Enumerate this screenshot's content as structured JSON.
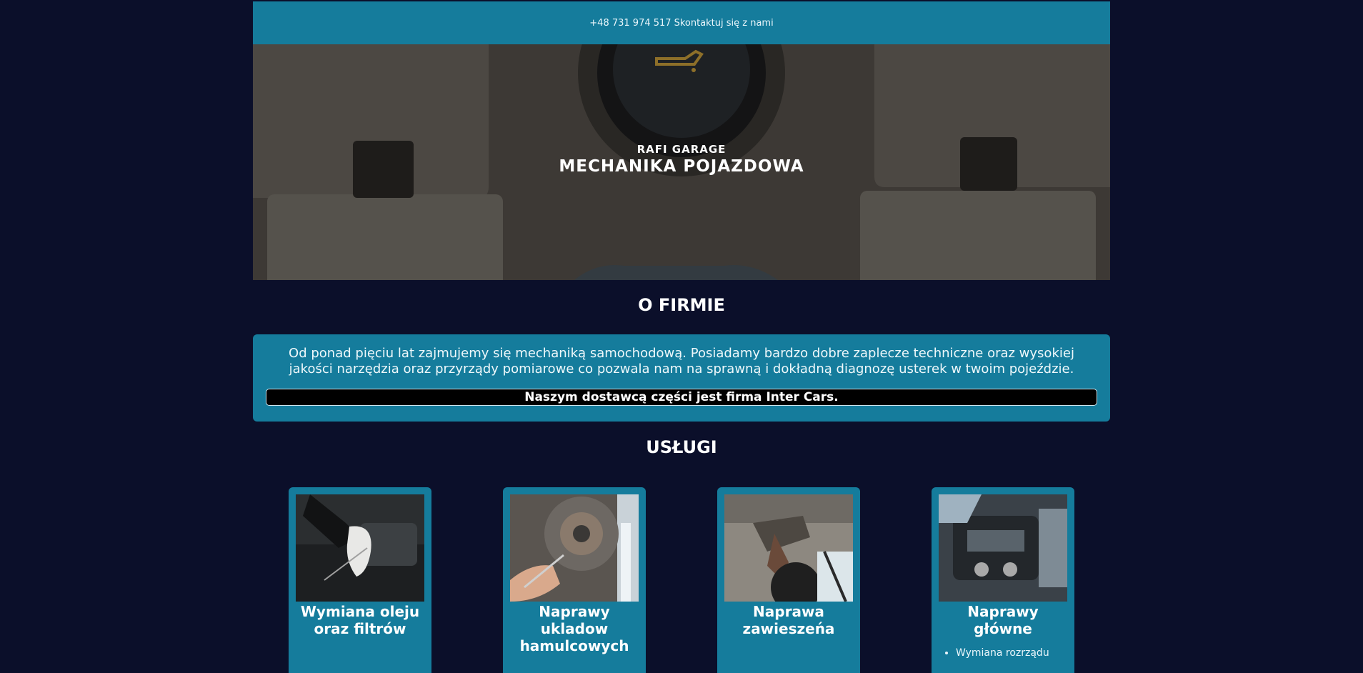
{
  "topbar": {
    "phone": "+48 731 974 517",
    "contact_label": "Skontaktuj się z nami"
  },
  "hero": {
    "brand": "RAFI GARAGE",
    "tagline": "MECHANIKA POJAZDOWA"
  },
  "about": {
    "title": "O FIRMIE",
    "text": "Od ponad pięciu lat zajmujemy się mechaniką samochodową. Posiadamy bardzo dobre zaplecze techniczne oraz wysokiej jakości narzędzia oraz przyrządy pomiarowe co pozwala nam na sprawną i dokładną diagnozę usterek w twoim pojeździe.",
    "supplier": "Naszym dostawcą części jest firma Inter Cars."
  },
  "services": {
    "title": "USŁUGI",
    "cards": [
      {
        "title": "Wymiana oleju oraz filtrów",
        "items": []
      },
      {
        "title": "Naprawy ukladow hamulcowych",
        "items": []
      },
      {
        "title": "Naprawa zawieszeńa",
        "items": []
      },
      {
        "title": "Naprawy główne",
        "items": [
          "Wymiana rozrządu"
        ]
      }
    ]
  },
  "colors": {
    "background": "#0b0f2a",
    "accent": "#157c9c",
    "supplier_bg": "#000000"
  }
}
